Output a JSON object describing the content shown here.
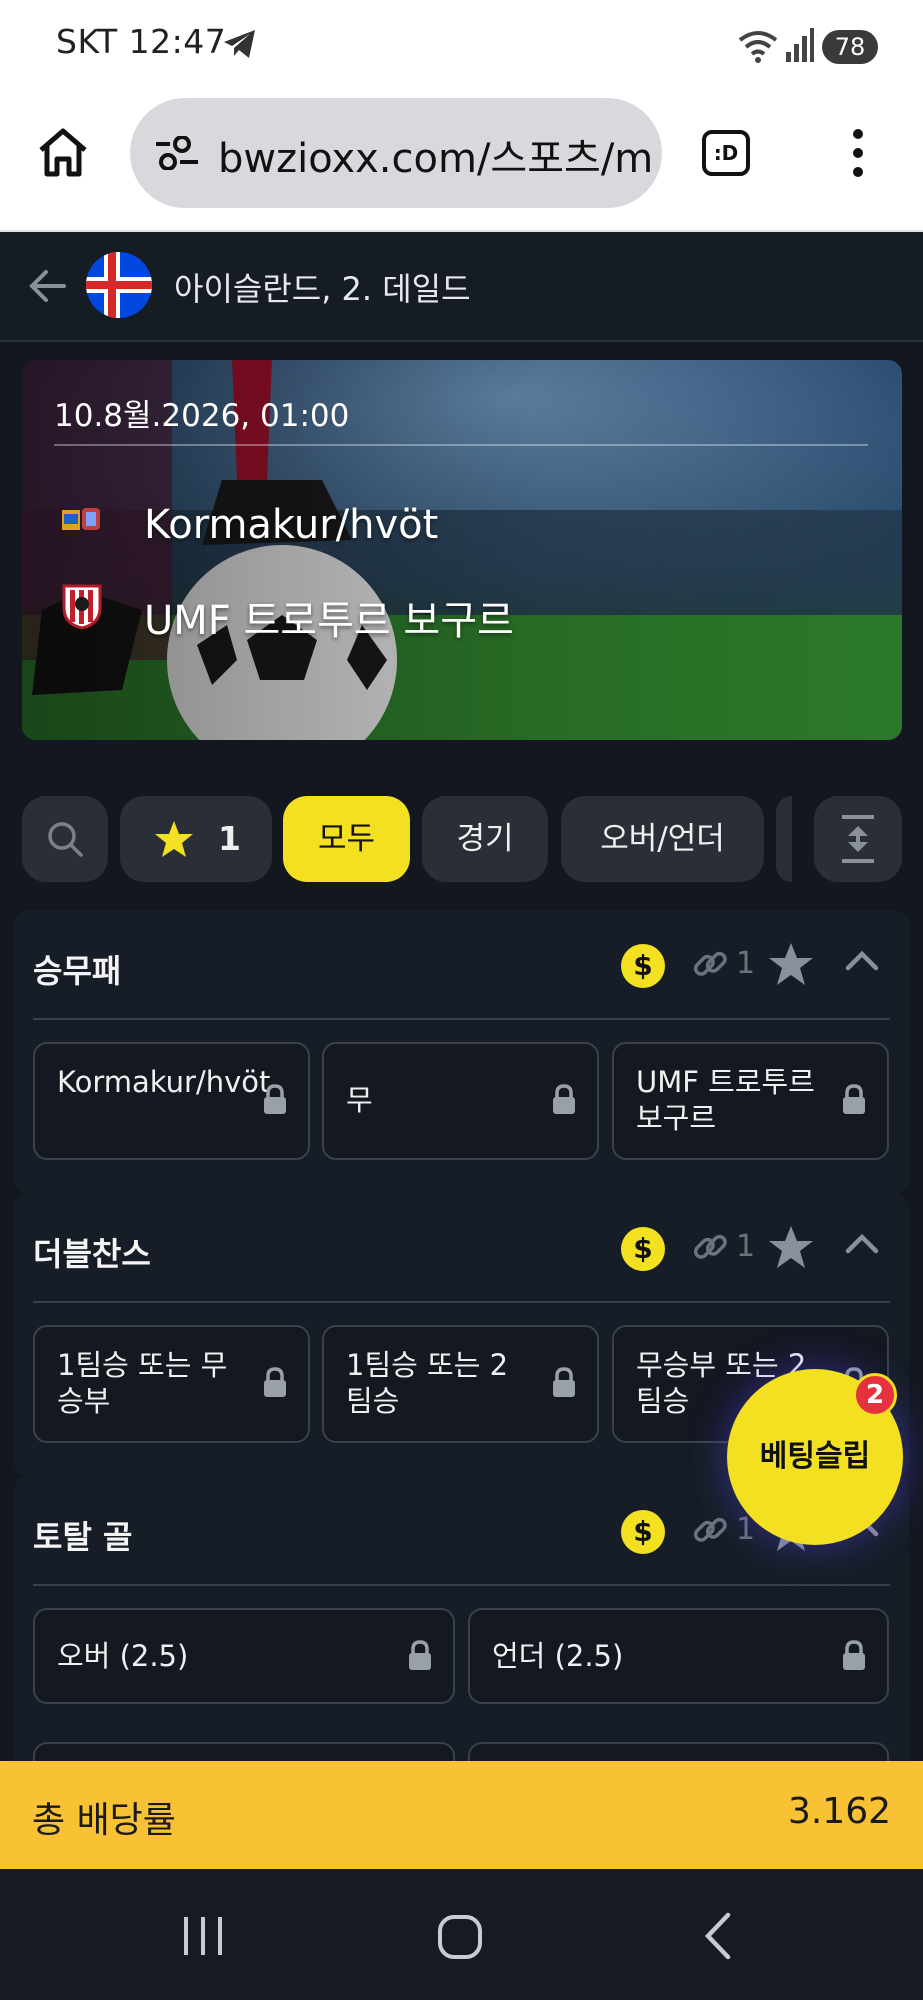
{
  "status_bar": {
    "carrier_time": "SKT 12:47",
    "battery": "78"
  },
  "browser": {
    "url": "bwzioxx.com/스포츠/m",
    "tabs_label": ":D"
  },
  "header": {
    "title": "아이슬란드, 2. 데일드"
  },
  "event": {
    "datetime": "10.8월.2026, 01:00",
    "home_team": "Kormakur/hvöt",
    "away_team": "UMF 트로투르 보구르"
  },
  "filters": {
    "favorites_count": "1",
    "tabs": [
      "모두",
      "경기",
      "오버/언더"
    ],
    "active": "모두"
  },
  "markets": [
    {
      "title": "승무패",
      "link_count": "1",
      "options": [
        "Kormakur/hvöt",
        "무",
        "UMF 트로투르 보구르"
      ]
    },
    {
      "title": "더블찬스",
      "link_count": "1",
      "options": [
        "1팀승 또는 무승부",
        "1팀승 또는 2팀승",
        "무승부 또는 2팀승"
      ]
    },
    {
      "title": "토탈 골",
      "link_count": "1",
      "options": [
        "오버 (2.5)",
        "언더 (2.5)"
      ]
    }
  ],
  "currency_symbol": "$",
  "bet_slip": {
    "label": "베팅슬립",
    "count": "2"
  },
  "odds_bar": {
    "label": "총 배당률",
    "value": "3.162"
  },
  "colors": {
    "accent": "#f2e021",
    "odds_bar": "#f9c234",
    "background": "#131820",
    "badge": "#e5323e"
  }
}
